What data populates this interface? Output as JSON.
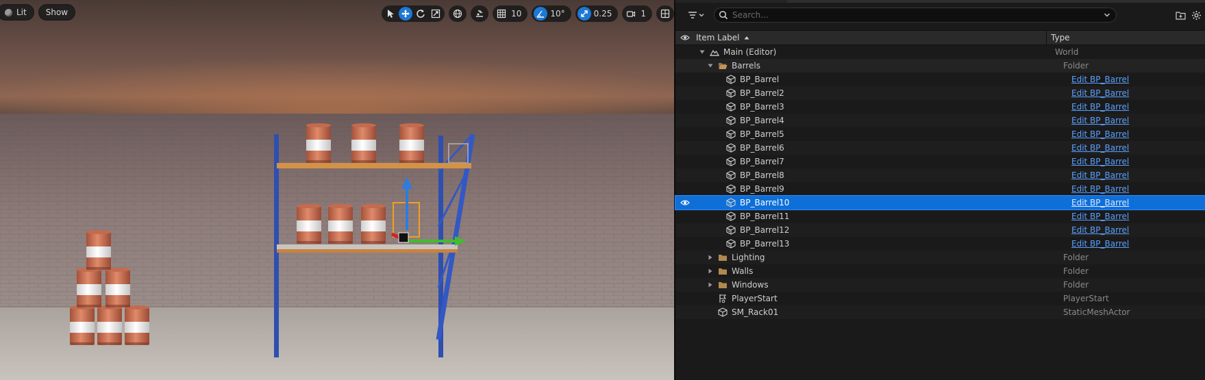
{
  "viewport": {
    "lit_label": "Lit",
    "show_label": "Show",
    "grid_snap_value": "10",
    "rotation_snap_value": "10°",
    "scale_snap_value": "0.25",
    "camera_speed_value": "1"
  },
  "outliner": {
    "search_placeholder": "Search...",
    "columns": {
      "label": "Item Label",
      "type": "Type"
    },
    "rows": [
      {
        "label": "Main (Editor)",
        "type": "World",
        "indent": 1,
        "icon": "world-icon",
        "expander": "open",
        "link": false
      },
      {
        "label": "Barrels",
        "type": "Folder",
        "indent": 2,
        "icon": "folder-open-icon",
        "expander": "open",
        "link": false
      },
      {
        "label": "BP_Barrel",
        "type": "Edit BP_Barrel",
        "indent": 3,
        "icon": "blueprint-actor-icon",
        "expander": "none",
        "link": true
      },
      {
        "label": "BP_Barrel2",
        "type": "Edit BP_Barrel",
        "indent": 3,
        "icon": "blueprint-actor-icon",
        "expander": "none",
        "link": true
      },
      {
        "label": "BP_Barrel3",
        "type": "Edit BP_Barrel",
        "indent": 3,
        "icon": "blueprint-actor-icon",
        "expander": "none",
        "link": true
      },
      {
        "label": "BP_Barrel4",
        "type": "Edit BP_Barrel",
        "indent": 3,
        "icon": "blueprint-actor-icon",
        "expander": "none",
        "link": true
      },
      {
        "label": "BP_Barrel5",
        "type": "Edit BP_Barrel",
        "indent": 3,
        "icon": "blueprint-actor-icon",
        "expander": "none",
        "link": true
      },
      {
        "label": "BP_Barrel6",
        "type": "Edit BP_Barrel",
        "indent": 3,
        "icon": "blueprint-actor-icon",
        "expander": "none",
        "link": true
      },
      {
        "label": "BP_Barrel7",
        "type": "Edit BP_Barrel",
        "indent": 3,
        "icon": "blueprint-actor-icon",
        "expander": "none",
        "link": true
      },
      {
        "label": "BP_Barrel8",
        "type": "Edit BP_Barrel",
        "indent": 3,
        "icon": "blueprint-actor-icon",
        "expander": "none",
        "link": true
      },
      {
        "label": "BP_Barrel9",
        "type": "Edit BP_Barrel",
        "indent": 3,
        "icon": "blueprint-actor-icon",
        "expander": "none",
        "link": true
      },
      {
        "label": "BP_Barrel10",
        "type": "Edit BP_Barrel",
        "indent": 3,
        "icon": "blueprint-actor-icon",
        "expander": "none",
        "link": true,
        "selected": true
      },
      {
        "label": "BP_Barrel11",
        "type": "Edit BP_Barrel",
        "indent": 3,
        "icon": "blueprint-actor-icon",
        "expander": "none",
        "link": true
      },
      {
        "label": "BP_Barrel12",
        "type": "Edit BP_Barrel",
        "indent": 3,
        "icon": "blueprint-actor-icon",
        "expander": "none",
        "link": true
      },
      {
        "label": "BP_Barrel13",
        "type": "Edit BP_Barrel",
        "indent": 3,
        "icon": "blueprint-actor-icon",
        "expander": "none",
        "link": true
      },
      {
        "label": "Lighting",
        "type": "Folder",
        "indent": 2,
        "icon": "folder-icon",
        "expander": "closed",
        "link": false
      },
      {
        "label": "Walls",
        "type": "Folder",
        "indent": 2,
        "icon": "folder-icon",
        "expander": "closed",
        "link": false
      },
      {
        "label": "Windows",
        "type": "Folder",
        "indent": 2,
        "icon": "folder-icon",
        "expander": "closed",
        "link": false
      },
      {
        "label": "PlayerStart",
        "type": "PlayerStart",
        "indent": 2,
        "icon": "player-start-icon",
        "expander": "none",
        "link": false
      },
      {
        "label": "SM_Rack01",
        "type": "StaticMeshActor",
        "indent": 2,
        "icon": "static-mesh-icon",
        "expander": "none",
        "link": false
      }
    ]
  },
  "colors": {
    "accent": "#0f6fd8",
    "link": "#5aa0ff",
    "folder": "#b3884f"
  }
}
